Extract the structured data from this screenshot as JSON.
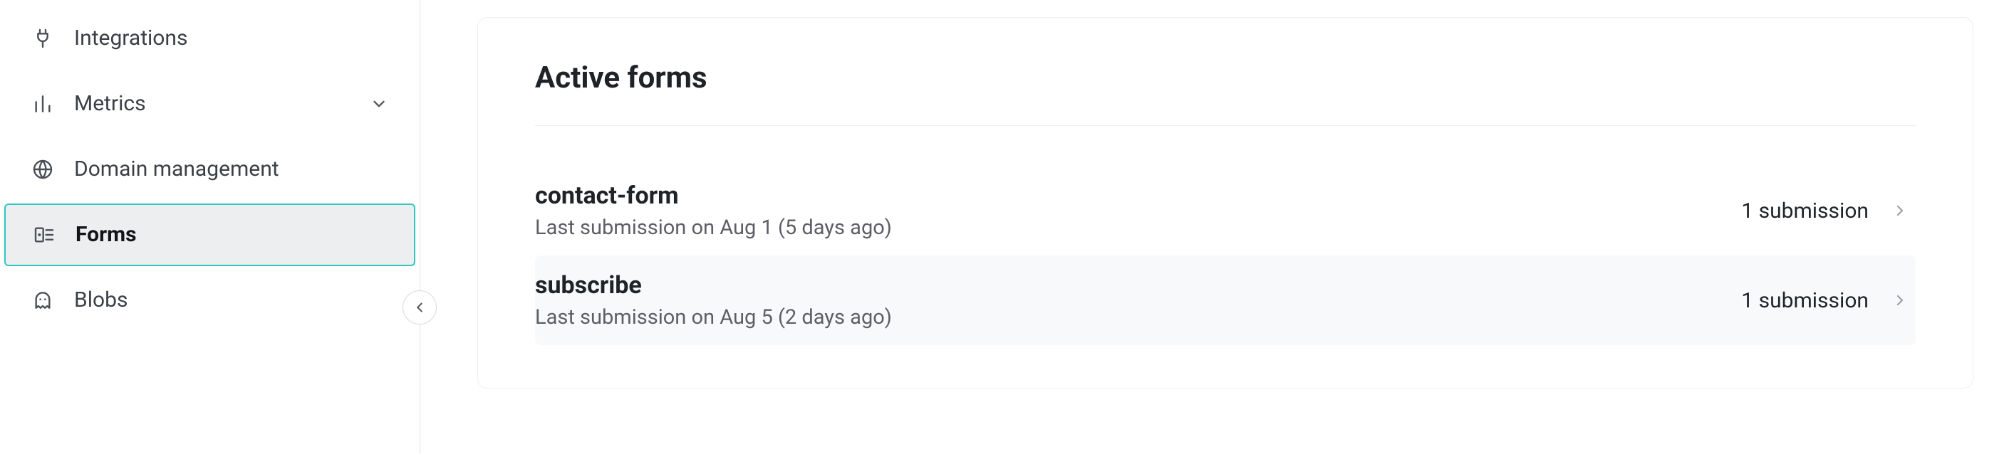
{
  "sidebar": {
    "items": [
      {
        "id": "integrations",
        "label": "Integrations",
        "icon": "plug-icon",
        "expandable": false
      },
      {
        "id": "metrics",
        "label": "Metrics",
        "icon": "barchart-icon",
        "expandable": true
      },
      {
        "id": "domain",
        "label": "Domain management",
        "icon": "globe-icon",
        "expandable": false
      },
      {
        "id": "forms",
        "label": "Forms",
        "icon": "form-icon",
        "expandable": false,
        "active": true
      },
      {
        "id": "blobs",
        "label": "Blobs",
        "icon": "ghost-icon",
        "expandable": false
      }
    ]
  },
  "main": {
    "card_title": "Active forms",
    "forms": [
      {
        "name": "contact-form",
        "meta": "Last submission on Aug 1 (5 days ago)",
        "count": "1 submission"
      },
      {
        "name": "subscribe",
        "meta": "Last submission on Aug 5 (2 days ago)",
        "count": "1 submission"
      }
    ]
  }
}
